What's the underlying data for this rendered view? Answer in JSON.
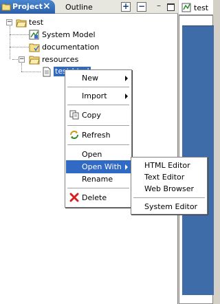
{
  "left_view": {
    "tabs": [
      {
        "label": "Project",
        "active": true
      },
      {
        "label": "Outline",
        "active": false
      }
    ],
    "toolbar": {
      "expand_icon": "plus-box",
      "collapse_icon": "minus-box",
      "minimize_glyph": "–"
    },
    "tree": {
      "root": {
        "label": "test",
        "expanded": true,
        "twisty": "−"
      },
      "children": [
        {
          "label": "System Model",
          "icon": "model-icon"
        },
        {
          "label": "documentation",
          "icon": "folder-icon"
        },
        {
          "label": "resources",
          "icon": "open-folder-icon",
          "expanded": true,
          "twisty": "−",
          "children": [
            {
              "label": "test.html",
              "icon": "file-icon",
              "selected": true
            }
          ]
        }
      ]
    }
  },
  "editor": {
    "tab_label": "test -",
    "accent_color": "#3e6ca8"
  },
  "context_menu": {
    "items": [
      {
        "label": "New",
        "submenu": true
      },
      {
        "label": "Import",
        "submenu": true
      },
      {
        "label": "Copy",
        "icon": "copy-icon"
      },
      {
        "label": "Refresh",
        "icon": "refresh-icon"
      },
      {
        "label": "Open"
      },
      {
        "label": "Open With",
        "submenu": true,
        "active": true
      },
      {
        "label": "Rename"
      },
      {
        "label": "Delete",
        "icon": "delete-icon"
      }
    ]
  },
  "open_with_menu": {
    "items": [
      {
        "label": "HTML Editor"
      },
      {
        "label": "Text Editor"
      },
      {
        "label": "Web Browser"
      },
      {
        "label": "System Editor"
      }
    ]
  },
  "colors": {
    "selection": "#316ac5",
    "active_tab": "#2c5fa8"
  }
}
